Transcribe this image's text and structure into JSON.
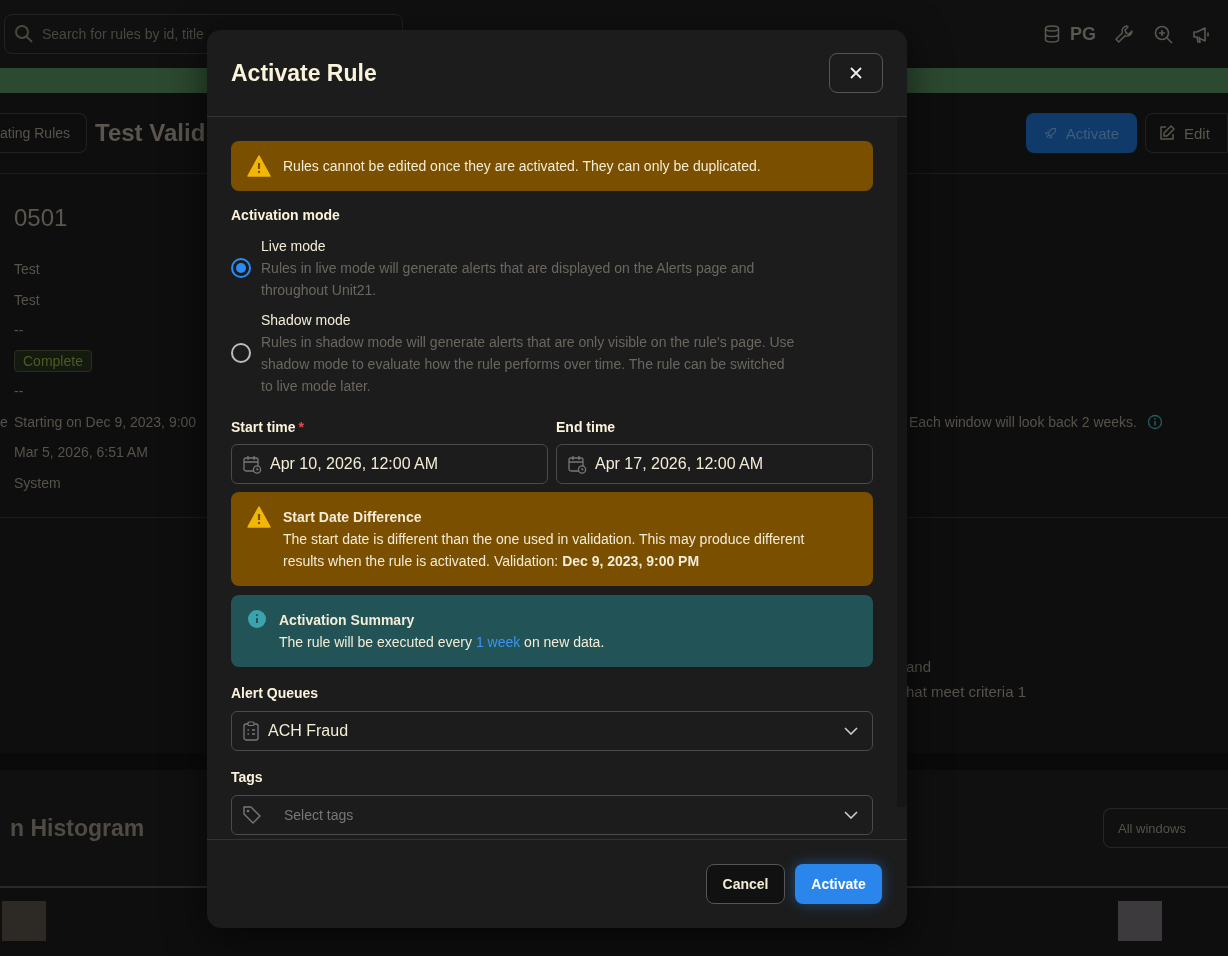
{
  "background": {
    "search": {
      "placeholder": "Search for rules by id, title"
    },
    "toolbar": {
      "initials": "PG"
    },
    "breadcrumb": "ating Rules",
    "title": "Test Valid",
    "header_buttons": [
      {
        "label": "Activate",
        "kind": "primary"
      },
      {
        "label": "Edit",
        "kind": "secondary"
      }
    ],
    "rule_id": "0501",
    "details": [
      {
        "value": "Test"
      },
      {
        "value": "Test"
      },
      {
        "value": "--"
      },
      {
        "value": "Complete",
        "kind": "badge"
      },
      {
        "value": "--"
      },
      {
        "label": "e",
        "value": "Starting on Dec 9, 2023, 9:00",
        "note": "Each window will look back 2 weeks."
      },
      {
        "value": "Mar 5, 2026, 6:51 AM"
      },
      {
        "value": "System"
      }
    ],
    "description_lines": [
      "and",
      "hat meet criteria 1"
    ],
    "histogram_title": "n Histogram",
    "window_select": {
      "placeholder": "All windows"
    }
  },
  "modal": {
    "title": "Activate Rule",
    "notice": "Rules cannot be edited once they are activated. They can only be duplicated.",
    "mode_label": "Activation mode",
    "modes": [
      {
        "label": "Live mode",
        "description": "Rules in live mode will generate alerts that are displayed on the Alerts page and throughout Unit21.",
        "selected": true
      },
      {
        "label": "Shadow mode",
        "description": "Rules in shadow mode will generate alerts that are only visible on the rule's page. Use shadow mode to evaluate how the rule performs over time. The rule can be switched to live mode later.",
        "selected": false
      }
    ],
    "times": [
      {
        "label": "Start time",
        "required_mark": "*",
        "value": "Apr 10, 2026, 12:00 AM"
      },
      {
        "label": "End time",
        "value": "Apr 17, 2026, 12:00 AM"
      }
    ],
    "date_warning": {
      "title": "Start Date Difference",
      "body": "The start date is different than the one used in validation. This may produce different results when the rule is activated. Validation: **Dec 9, 2023, 9:00 PM**"
    },
    "summary": {
      "title": "Activation Summary",
      "before": "The rule will be executed every ",
      "link": "1 week",
      "after": " on new data."
    },
    "queues": {
      "label": "Alert Queues",
      "value": "ACH Fraud"
    },
    "tags": {
      "label": "Tags",
      "placeholder": "Select tags"
    },
    "buttons": [
      {
        "label": "Cancel",
        "kind": "secondary"
      },
      {
        "label": "Activate",
        "kind": "primary"
      }
    ]
  }
}
